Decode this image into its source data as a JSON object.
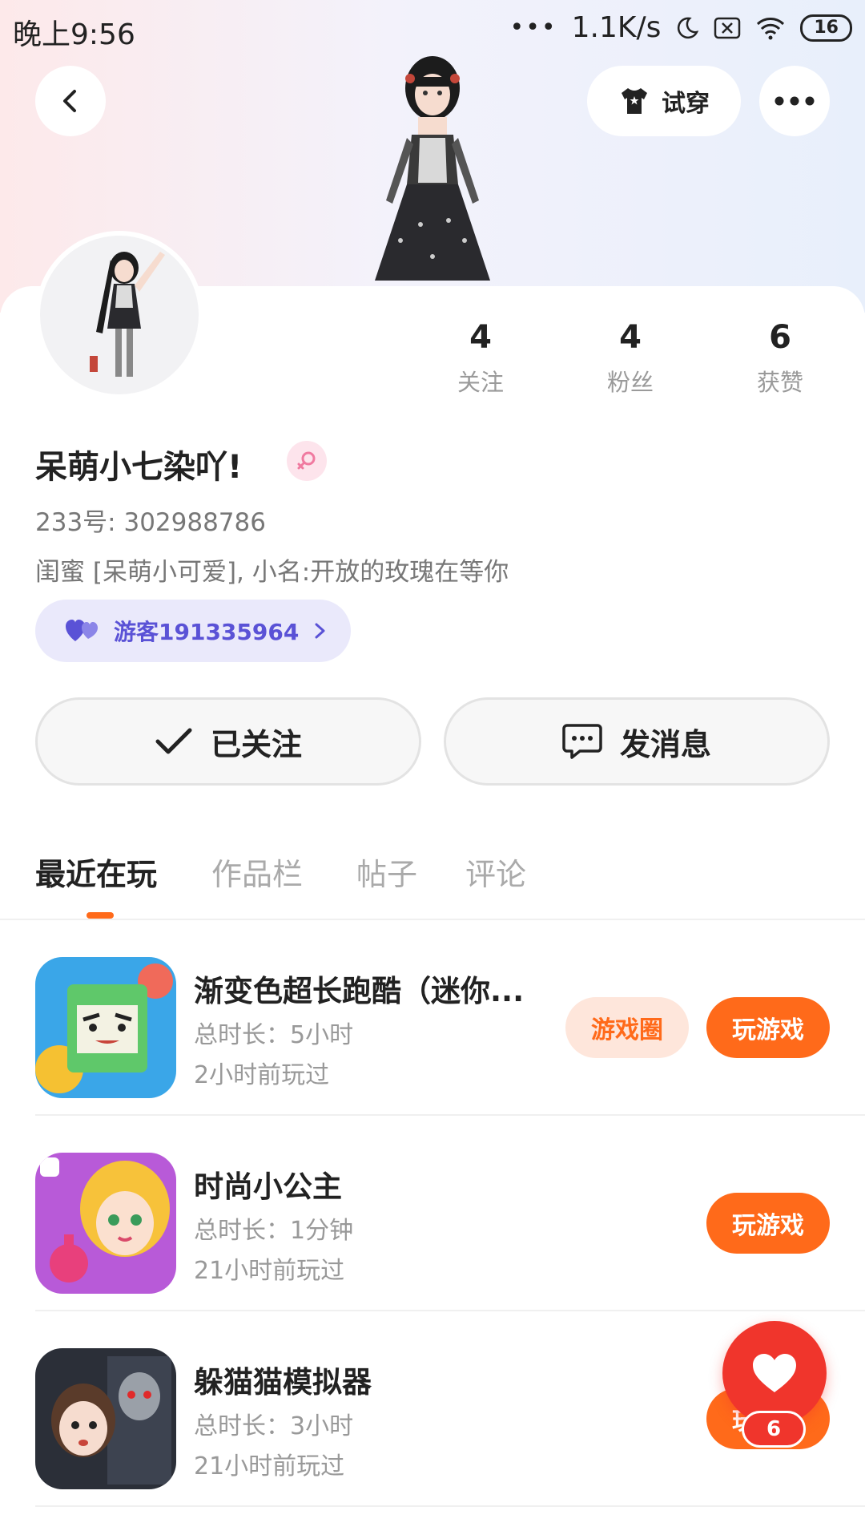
{
  "status_bar": {
    "time": "晚上9:56",
    "network_speed": "1.1K/s",
    "battery": "16"
  },
  "header": {
    "try_on_label": "试穿"
  },
  "profile": {
    "stats": [
      {
        "value": "4",
        "label": "关注"
      },
      {
        "value": "4",
        "label": "粉丝"
      },
      {
        "value": "6",
        "label": "获赞"
      }
    ],
    "name": "呆萌小七染吖!",
    "uid": "233号: 302988786",
    "bio": "闺蜜 [呆萌小可爱], 小名:开放的玫瑰在等你",
    "relation_tag": "游客191335964"
  },
  "actions": {
    "follow_label": "已关注",
    "message_label": "发消息"
  },
  "tabs": [
    {
      "label": "最近在玩"
    },
    {
      "label": "作品栏"
    },
    {
      "label": "帖子"
    },
    {
      "label": "评论"
    }
  ],
  "games": [
    {
      "title": "渐变色超长跑酷（迷你...",
      "duration": "总时长：5小时",
      "last_played": "2小时前玩过",
      "circle_label": "游戏圈",
      "play_label": "玩游戏"
    },
    {
      "title": "时尚小公主",
      "duration": "总时长：1分钟",
      "last_played": "21小时前玩过",
      "play_label": "玩游戏"
    },
    {
      "title": "躲猫猫模拟器",
      "duration": "总时长：3小时",
      "last_played": "21小时前玩过",
      "play_label": "玩游戏"
    }
  ],
  "fab": {
    "like_count": "6"
  },
  "colors": {
    "accent": "#ff6a1a",
    "like_red": "#f0352c",
    "tag_purple": "#5a52d6"
  }
}
